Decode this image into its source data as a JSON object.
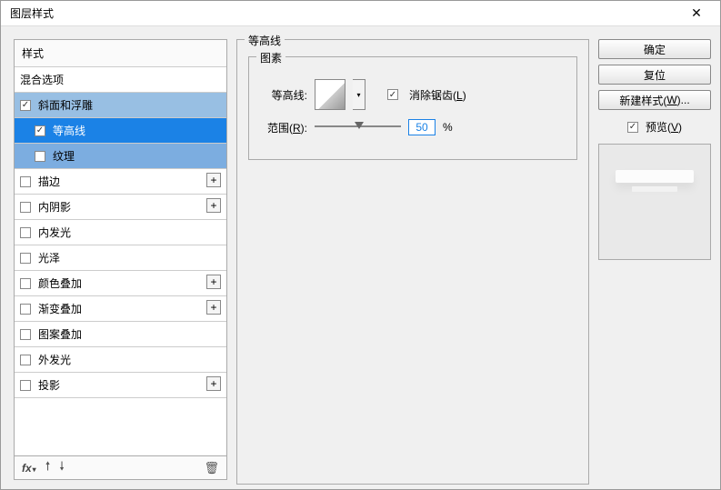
{
  "window": {
    "title": "图层样式"
  },
  "sidebar": {
    "header": "样式",
    "items": [
      {
        "label": "混合选项",
        "checkbox": false,
        "checked": false,
        "plus": false,
        "indent": 0,
        "state": "none"
      },
      {
        "label": "斜面和浮雕",
        "checkbox": true,
        "checked": true,
        "plus": false,
        "indent": 0,
        "state": "medium"
      },
      {
        "label": "等高线",
        "checkbox": true,
        "checked": true,
        "plus": false,
        "indent": 1,
        "state": "dark"
      },
      {
        "label": "纹理",
        "checkbox": true,
        "checked": false,
        "plus": false,
        "indent": 1,
        "state": "light"
      },
      {
        "label": "描边",
        "checkbox": true,
        "checked": false,
        "plus": true,
        "indent": 0,
        "state": "none"
      },
      {
        "label": "内阴影",
        "checkbox": true,
        "checked": false,
        "plus": true,
        "indent": 0,
        "state": "none"
      },
      {
        "label": "内发光",
        "checkbox": true,
        "checked": false,
        "plus": false,
        "indent": 0,
        "state": "none"
      },
      {
        "label": "光泽",
        "checkbox": true,
        "checked": false,
        "plus": false,
        "indent": 0,
        "state": "none"
      },
      {
        "label": "颜色叠加",
        "checkbox": true,
        "checked": false,
        "plus": true,
        "indent": 0,
        "state": "none"
      },
      {
        "label": "渐变叠加",
        "checkbox": true,
        "checked": false,
        "plus": true,
        "indent": 0,
        "state": "none"
      },
      {
        "label": "图案叠加",
        "checkbox": true,
        "checked": false,
        "plus": false,
        "indent": 0,
        "state": "none"
      },
      {
        "label": "外发光",
        "checkbox": true,
        "checked": false,
        "plus": false,
        "indent": 0,
        "state": "none"
      },
      {
        "label": "投影",
        "checkbox": true,
        "checked": false,
        "plus": true,
        "indent": 0,
        "state": "none"
      }
    ]
  },
  "main": {
    "section_title": "等高线",
    "group_title": "图素",
    "contour_label": "等高线:",
    "antialias_label": "消除锯齿(",
    "antialias_key": "L",
    "antialias_tail": ")",
    "antialias_checked": true,
    "range_label": "范围(",
    "range_key": "R",
    "range_tail": "):",
    "range_value": "50",
    "range_suffix": "%"
  },
  "right": {
    "ok": "确定",
    "cancel": "复位",
    "new_style": "新建样式(",
    "new_style_key": "W",
    "new_style_tail": ")...",
    "preview_label": "预览(",
    "preview_key": "V",
    "preview_tail": ")",
    "preview_checked": true
  }
}
